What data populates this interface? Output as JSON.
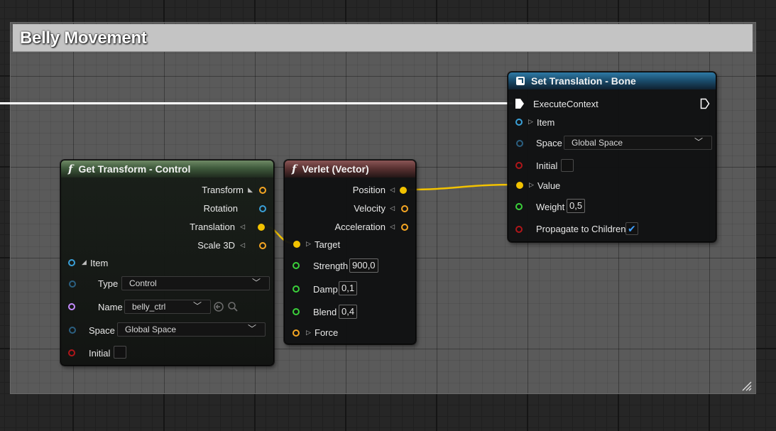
{
  "comment": {
    "title": "Belly Movement"
  },
  "colors": {
    "exec_wire": "#ffffff",
    "vector_wire": "#f2c200",
    "vector_pin": "#f2c200",
    "struct_pin": "#3aa0d8",
    "float_pin": "#3bd13b",
    "bool_pin": "#b0161a",
    "name_pin": "#c58cff",
    "orange_pin": "#f5a623",
    "check": "#3fa0ff"
  },
  "get_transform": {
    "glyph": "f",
    "title": "Get Transform - Control",
    "outputs": {
      "transform": "Transform",
      "rotation": "Rotation",
      "translation": "Translation",
      "scale3d": "Scale 3D"
    },
    "item_label": "Item",
    "type_label": "Type",
    "type_value": "Control",
    "name_label": "Name",
    "name_value": "belly_ctrl",
    "space_label": "Space",
    "space_value": "Global Space",
    "initial_label": "Initial",
    "icons": [
      "use-selected-icon",
      "browse-icon"
    ]
  },
  "verlet": {
    "glyph": "f",
    "title": "Verlet (Vector)",
    "outputs": {
      "position": "Position",
      "velocity": "Velocity",
      "acceleration": "Acceleration"
    },
    "target_label": "Target",
    "strength_label": "Strength",
    "strength_value": "900,0",
    "damp_label": "Damp",
    "damp_value": "0,1",
    "blend_label": "Blend",
    "blend_value": "0,4",
    "force_label": "Force"
  },
  "set_translation": {
    "title": "Set Translation - Bone",
    "execute_label": "ExecuteContext",
    "item_label": "Item",
    "space_label": "Space",
    "space_value": "Global Space",
    "initial_label": "Initial",
    "value_label": "Value",
    "weight_label": "Weight",
    "weight_value": "0,5",
    "propagate_label": "Propagate to Children",
    "propagate_checked": true
  }
}
